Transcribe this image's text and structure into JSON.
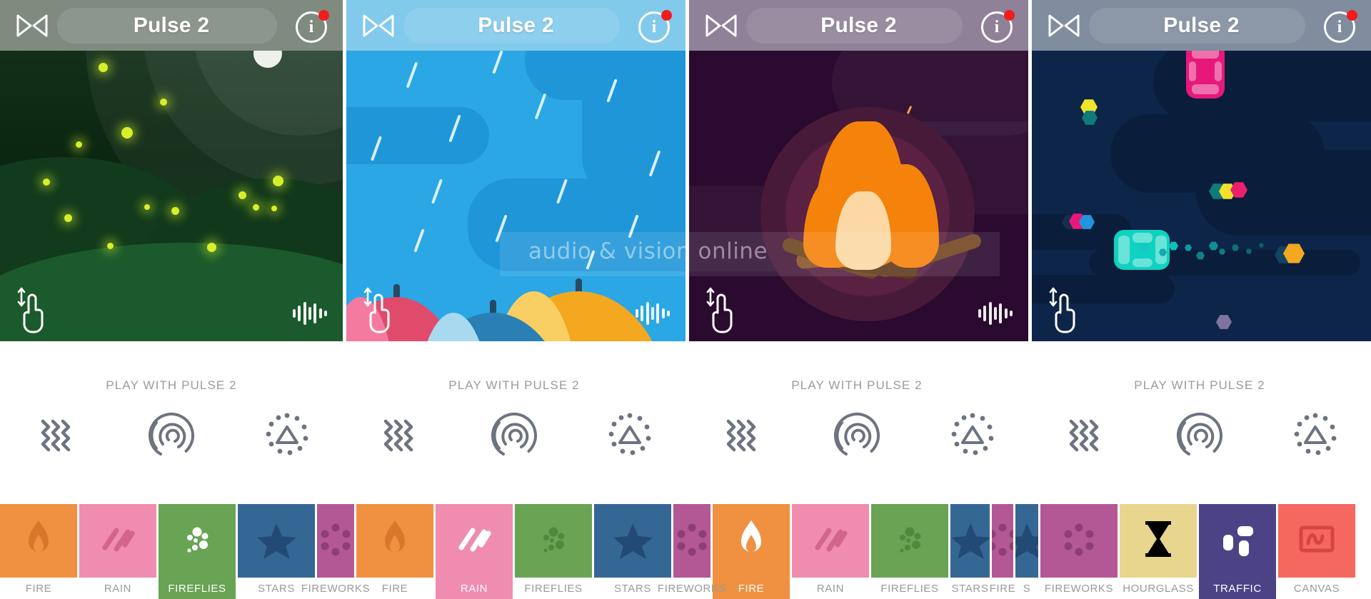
{
  "app": {
    "title": "Pulse 2",
    "watermark": "audio & vision online"
  },
  "panels": [
    {
      "scene": "fireflies",
      "title": "Pulse 2",
      "header_bg": "#5d6b5c",
      "scene_bg": "#0b2612",
      "bowtie_icon": "bowtie-icon",
      "info_icon": "info-icon",
      "info_badge": true,
      "hand_icon": "swipe-hand-icon",
      "wave_icon": "audio-waveform-icon",
      "play_label": "PLAY WITH PULSE 2",
      "play_icons": [
        "vibration-icon",
        "pulse-ripple-icon",
        "sparkle-triangle-icon"
      ]
    },
    {
      "scene": "rain",
      "title": "Pulse 2",
      "header_bg": "#5fbbe6",
      "scene_bg": "#2aa7e4",
      "bowtie_icon": "bowtie-icon",
      "info_icon": "info-icon",
      "info_badge": true,
      "hand_icon": "swipe-hand-icon",
      "wave_icon": "audio-waveform-icon",
      "play_label": "PLAY WITH PULSE 2",
      "play_icons": [
        "vibration-icon",
        "pulse-ripple-icon",
        "sparkle-triangle-icon"
      ]
    },
    {
      "scene": "fire",
      "title": "Pulse 2",
      "header_bg": "#6f5e7c",
      "scene_bg": "#2a0a2e",
      "bowtie_icon": "bowtie-icon",
      "info_icon": "info-icon",
      "info_badge": true,
      "hand_icon": "swipe-hand-icon",
      "wave_icon": "audio-waveform-icon",
      "play_label": "PLAY WITH PULSE 2",
      "play_icons": [
        "vibration-icon",
        "pulse-ripple-icon",
        "sparkle-triangle-icon"
      ]
    },
    {
      "scene": "traffic",
      "title": "Pulse 2",
      "header_bg": "#5b6d85",
      "scene_bg": "#0d2549",
      "bowtie_icon": "bowtie-icon",
      "info_icon": "info-icon",
      "info_badge": true,
      "hand_icon": "swipe-hand-icon",
      "wave_icon": "audio-waveform-icon",
      "play_label": "PLAY WITH PULSE 2",
      "play_icons": [
        "vibration-icon",
        "pulse-ripple-icon",
        "sparkle-triangle-icon"
      ]
    }
  ],
  "carousel": [
    {
      "label": "FIRE",
      "glyph": "flame-icon",
      "bg": "#ef9140",
      "fg": "#d9762a",
      "selected": false
    },
    {
      "label": "RAIN",
      "glyph": "rain-icon",
      "bg": "#f08cb0",
      "fg": "#d2648d",
      "selected": false
    },
    {
      "label": "FIREFLIES",
      "glyph": "fireflies-icon",
      "bg": "#69a354",
      "fg": "#4f8a3c",
      "selected": true
    },
    {
      "label": "STARS",
      "glyph": "star-icon",
      "bg": "#356794",
      "fg": "#234a75",
      "selected": false
    },
    {
      "label": "FIREWORKS",
      "glyph": "fireworks-icon",
      "bg": "#b35795",
      "fg": "#8d3f74",
      "selected": false
    },
    {
      "label": "FIRE",
      "glyph": "flame-icon",
      "bg": "#ef9140",
      "fg": "#d9762a",
      "selected": false
    },
    {
      "label": "RAIN",
      "glyph": "rain-icon",
      "bg": "#f08cb0",
      "fg": "#ffffff",
      "selected": true
    },
    {
      "label": "FIREFLIES",
      "glyph": "fireflies-icon",
      "bg": "#69a354",
      "fg": "#4f8a3c",
      "selected": false
    },
    {
      "label": "STARS",
      "glyph": "star-icon",
      "bg": "#356794",
      "fg": "#234a75",
      "selected": false
    },
    {
      "label": "FIREWORKS",
      "glyph": "fireworks-icon",
      "bg": "#b35795",
      "fg": "#8d3f74",
      "selected": false
    },
    {
      "label": "FIRE",
      "glyph": "flame-icon",
      "bg": "#ef9140",
      "fg": "#ffffff",
      "selected": true
    },
    {
      "label": "RAIN",
      "glyph": "rain-icon",
      "bg": "#f08cb0",
      "fg": "#d2648d",
      "selected": false
    },
    {
      "label": "FIREFLIES",
      "glyph": "fireflies-icon",
      "bg": "#69a354",
      "fg": "#4f8a3c",
      "selected": false
    },
    {
      "label": "STARS",
      "glyph": "star-icon",
      "bg": "#356794",
      "fg": "#234a75",
      "selected": false
    },
    {
      "label": "FIRE",
      "glyph": "fireworks-icon",
      "bg": "#b35795",
      "fg": "#8d3f74",
      "selected": false
    },
    {
      "label": "S",
      "glyph": "star-icon",
      "bg": "#356794",
      "fg": "#234a75",
      "selected": false
    },
    {
      "label": "FIREWORKS",
      "glyph": "fireworks-icon",
      "bg": "#b35795",
      "fg": "#8d3f74",
      "selected": false
    },
    {
      "label": "HOURGLASS",
      "glyph": "hourglass-icon",
      "bg": "#e8d58e",
      "fg": "#c4a košice",
      "selected": false
    },
    {
      "label": "TRAFFIC",
      "glyph": "traffic-icon",
      "bg": "#4c4387",
      "fg": "#ffffff",
      "selected": true
    },
    {
      "label": "CANVAS",
      "glyph": "canvas-icon",
      "bg": "#f4685f",
      "fg": "#d6463e",
      "selected": false
    }
  ]
}
